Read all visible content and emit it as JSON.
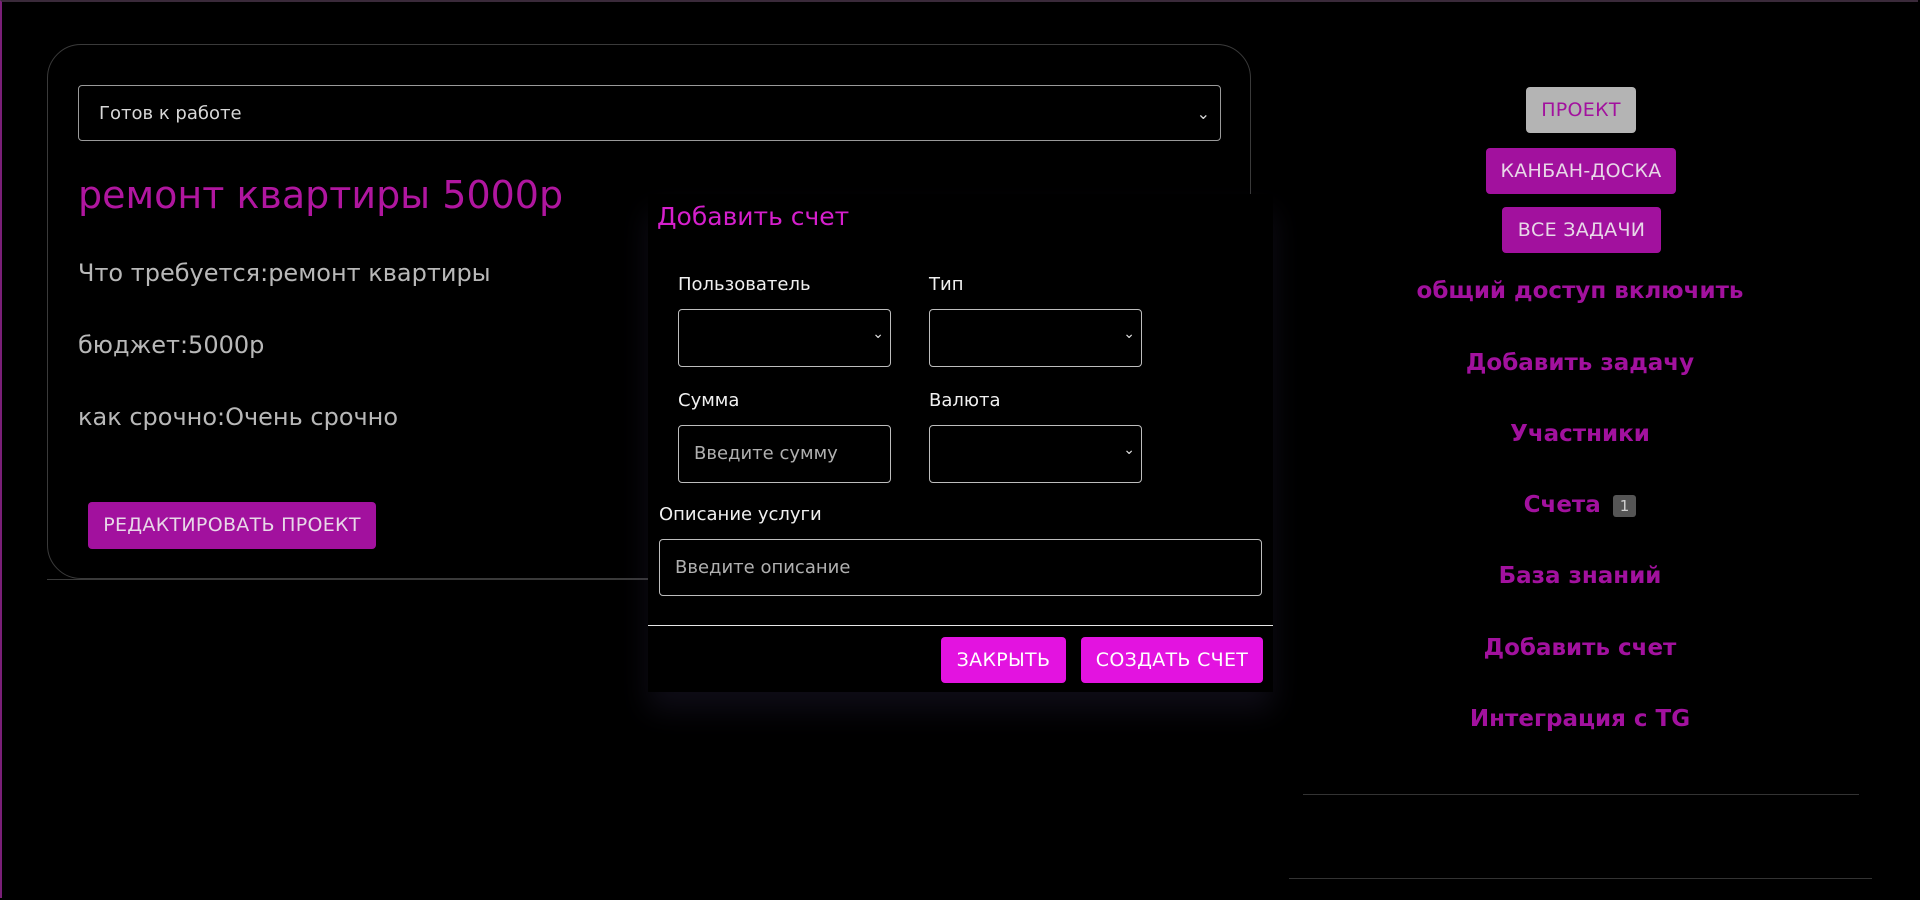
{
  "project": {
    "status": "Готов к работе",
    "title": "ремонт квартиры 5000р",
    "fields": [
      "Что требуется:ремонт квартиры",
      "бюджет:5000р",
      "как срочно:Очень срочно"
    ],
    "edit_button": "РЕДАКТИРОВАТЬ ПРОЕКТ"
  },
  "sidebar": {
    "project_button": "ПРОЕКТ",
    "kanban_button": "КАНБАН-ДОСКА",
    "tasks_button": "ВСЕ ЗАДАЧИ",
    "links": {
      "share": "общий доступ включить",
      "add_task": "Добавить задачу",
      "members": "Участники",
      "invoices": "Счета",
      "invoices_count": "1",
      "knowledge": "База знаний",
      "add_invoice": "Добавить счет",
      "tg": "Интеграция с TG"
    }
  },
  "modal": {
    "title": "Добавить счет",
    "user_label": "Пользователь",
    "type_label": "Тип",
    "amount_label": "Сумма",
    "amount_placeholder": "Введите сумму",
    "currency_label": "Валюта",
    "description_label": "Описание услуги",
    "description_placeholder": "Введите описание",
    "close_button": "ЗАКРЫТЬ",
    "create_button": "СОЗДАТЬ СЧЕТ"
  },
  "colors": {
    "accent": "#a2119e",
    "modal_accent": "#e313e0",
    "background": "#000000"
  },
  "icons": {
    "select_arrow": "chevron-down-icon"
  }
}
